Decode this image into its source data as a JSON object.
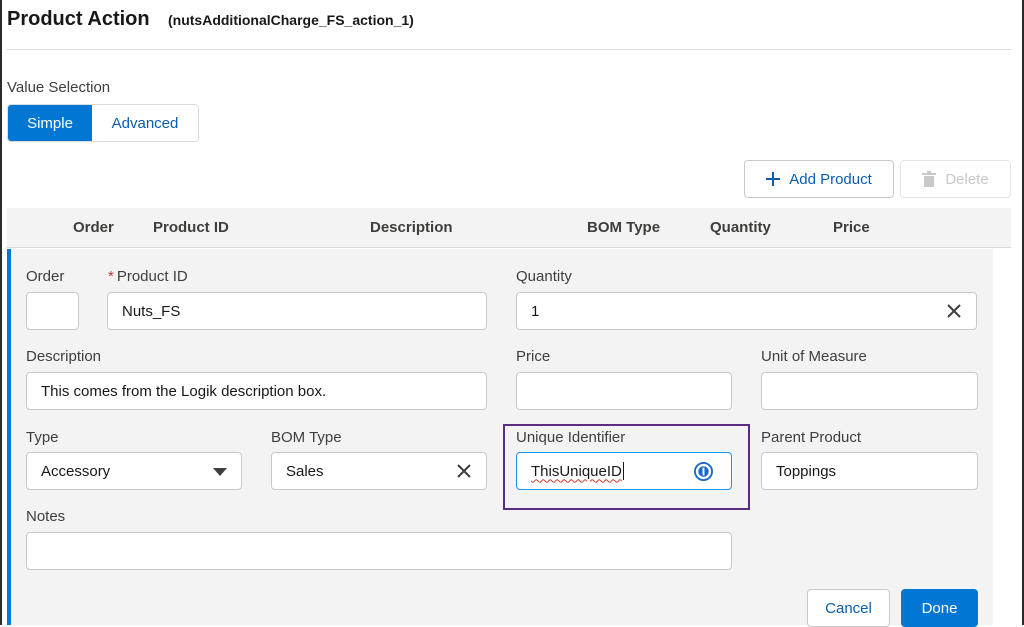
{
  "header": {
    "title": "Product Action",
    "api_name": "(nutsAdditionalCharge_FS_action_1)"
  },
  "value_selection": {
    "label": "Value Selection",
    "options": [
      "Simple",
      "Advanced"
    ],
    "selected": "Simple"
  },
  "toolbar": {
    "add_label": "Add Product",
    "add_icon": "plus-icon",
    "delete_label": "Delete",
    "delete_icon": "trash-icon"
  },
  "table": {
    "columns": [
      "Order",
      "Product ID",
      "Description",
      "BOM Type",
      "Quantity",
      "Price"
    ]
  },
  "form": {
    "order": {
      "label": "Order",
      "value": ""
    },
    "product_id": {
      "label": "Product ID",
      "required_mark": "*",
      "value": "Nuts_FS"
    },
    "quantity": {
      "label": "Quantity",
      "value": "1"
    },
    "description": {
      "label": "Description",
      "value": "This comes from the Logik description box."
    },
    "price": {
      "label": "Price",
      "value": ""
    },
    "unit_of_measure": {
      "label": "Unit of Measure",
      "value": ""
    },
    "type": {
      "label": "Type",
      "value": "Accessory"
    },
    "bom_type": {
      "label": "BOM Type",
      "value": "Sales"
    },
    "unique_identifier": {
      "label": "Unique Identifier",
      "value": "ThisUniqueID"
    },
    "parent_product": {
      "label": "Parent Product",
      "value": "Toppings"
    },
    "notes": {
      "label": "Notes",
      "value": ""
    }
  },
  "actions": {
    "cancel_label": "Cancel",
    "done_label": "Done"
  },
  "colors": {
    "brand": "#0176d3",
    "link": "#0b5cab",
    "required": "#c23934",
    "highlight": "#5b2d82"
  }
}
